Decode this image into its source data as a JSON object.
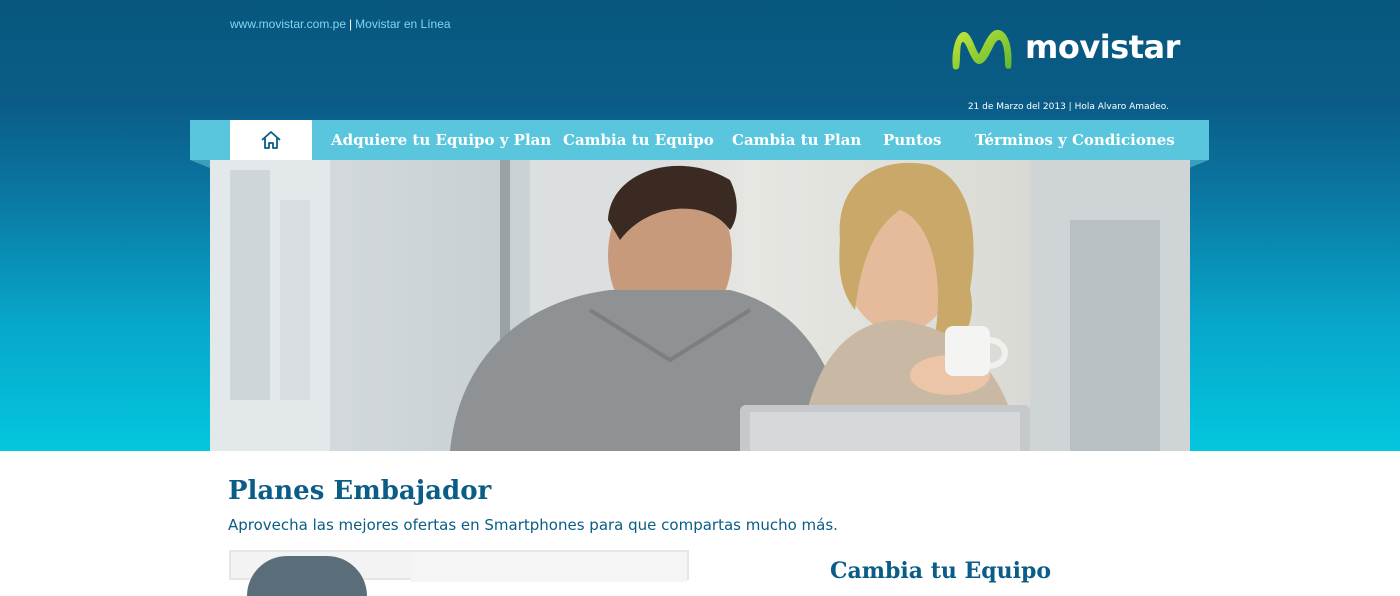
{
  "header": {
    "link_site": "www.movistar.com.pe",
    "separator": "|",
    "link_online": "Movistar en Línea",
    "brand": "movistar",
    "greeting": "21 de Marzo del 2013 | Hola Alvaro Amadeo."
  },
  "nav": {
    "home_icon": "home-icon",
    "items": [
      {
        "label": "Adquiere tu Equipo y Plan"
      },
      {
        "label": "Cambia tu Equipo"
      },
      {
        "label": "Cambia tu Plan"
      },
      {
        "label": "Puntos"
      },
      {
        "label": "Términos y Condiciones"
      }
    ]
  },
  "content": {
    "title": "Planes Embajador",
    "subtitle": "Aprovecha las mejores ofertas en Smartphones para que compartas mucho más.",
    "right_title": "Cambia tu Equipo"
  },
  "colors": {
    "header_bg": "#0a5d86",
    "nav_bg": "#5ac6de",
    "accent_text": "#0a5d86",
    "hero_bottom": "#03c7de"
  }
}
